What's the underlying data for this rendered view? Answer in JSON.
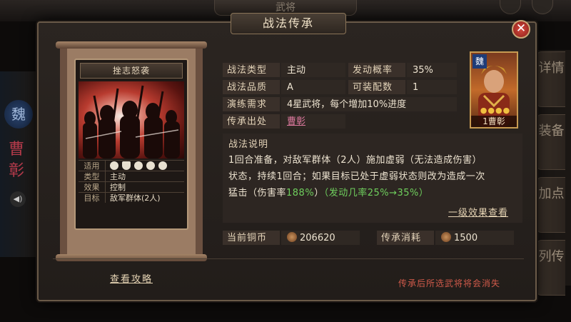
{
  "background": {
    "top_title": "武将",
    "side_kingdom": "魏",
    "side_general": "曹彰",
    "right_tabs": [
      "详情",
      "装备",
      "加点",
      "列传"
    ]
  },
  "dialog": {
    "title": "战法传承",
    "close_label": "✕"
  },
  "card": {
    "name": "挫志怒袭",
    "rows": [
      {
        "key": "适用",
        "value": ""
      },
      {
        "key": "类型",
        "value": "主动"
      },
      {
        "key": "效果",
        "value": "控制"
      },
      {
        "key": "目标",
        "value": "敌军群体(2人)"
      }
    ],
    "applicable_icons": [
      "cavalry-icon",
      "shield-icon",
      "bow-icon",
      "spear-icon",
      "siege-icon"
    ]
  },
  "info": {
    "type_label": "战法类型",
    "type_value": "主动",
    "rate_label": "发动概率",
    "rate_value": "35%",
    "quality_label": "战法品质",
    "quality_value": "A",
    "equip_label": "可装配数",
    "equip_value": "1",
    "req_label": "演练需求",
    "req_value": "4星武将，每个增加10%进度",
    "source_label": "传承出处",
    "source_value": "曹彰"
  },
  "description": {
    "title": "战法说明",
    "line1": "1回合准备，对敌军群体（2人）施加虚弱（无法造成伤害）",
    "line2": "状态，持续1回合；如果目标已处于虚弱状态则改为造成一次",
    "line3_a": "猛击（伤害率",
    "line3_b": "188%",
    "line3_c": "）",
    "line3_d": "（发动几率25%→35%）",
    "effect_link": "一级效果查看"
  },
  "costs": {
    "copper_label": "当前铜币",
    "copper_value": "206620",
    "inherit_label": "传承消耗",
    "inherit_value": "1500"
  },
  "footer": {
    "guide_link": "查看攻略",
    "warning": "传承后所选武将将会消失"
  },
  "portrait": {
    "faction": "魏",
    "stars": "●●●●",
    "name": "1曹彰"
  }
}
